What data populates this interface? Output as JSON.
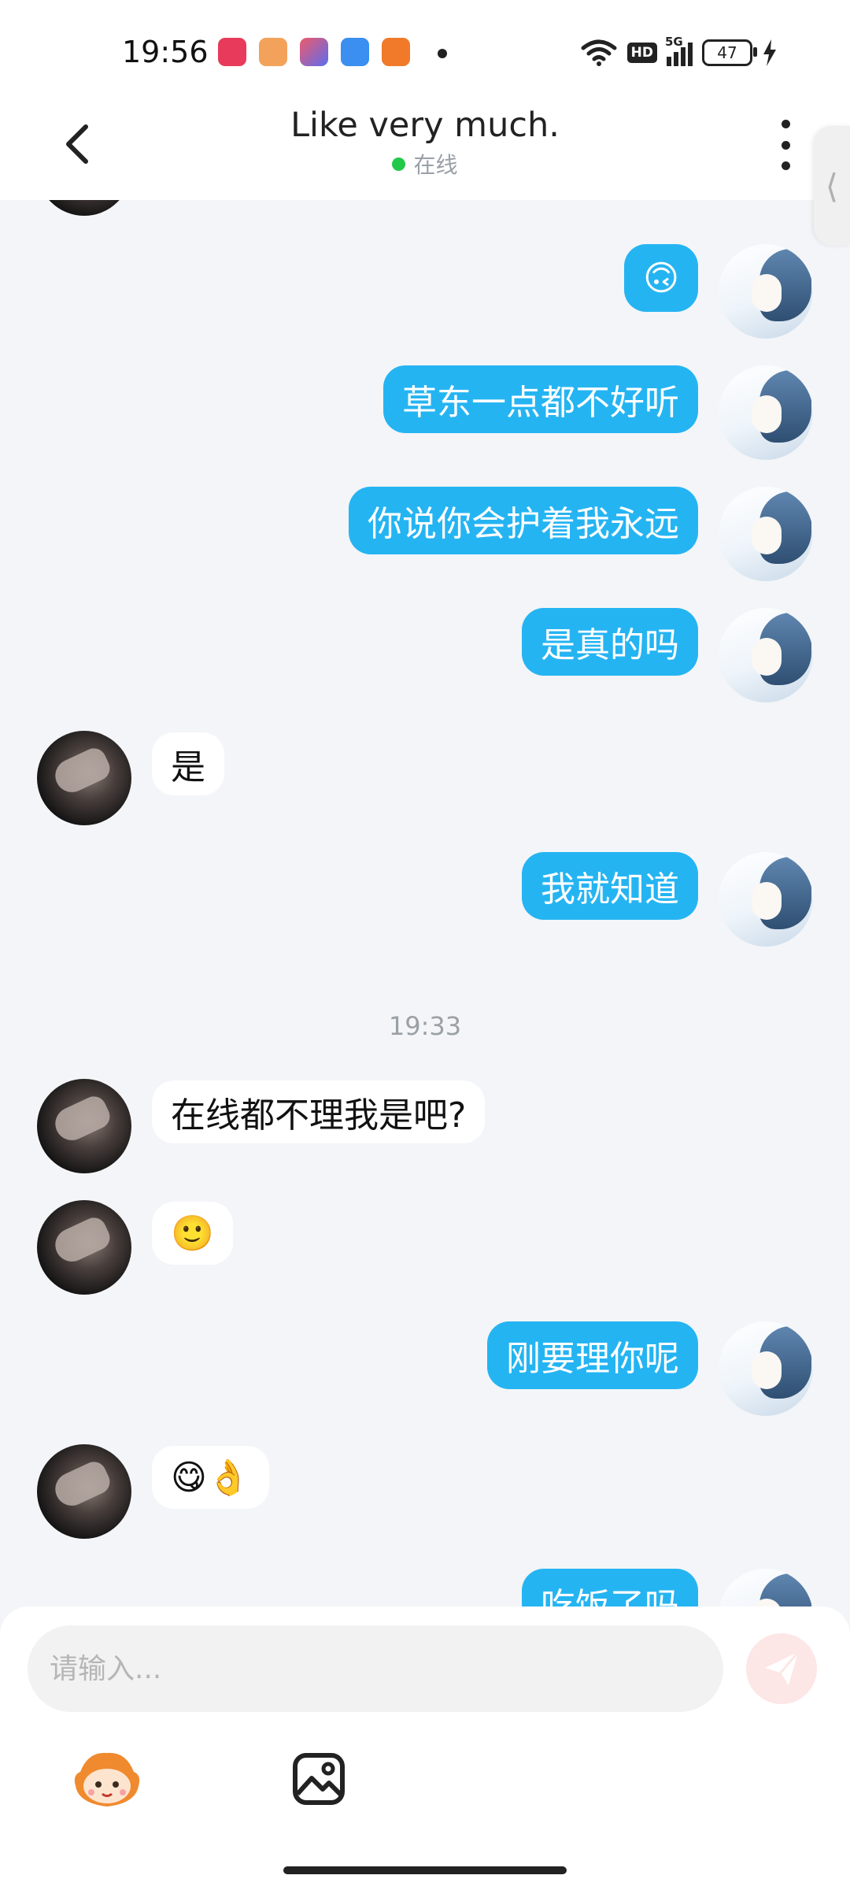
{
  "status_bar": {
    "time": "19:56",
    "battery": "47",
    "hd_label": "HD",
    "network": "5G",
    "app_icon_colors": [
      "#e83a5b",
      "#f06a2a",
      "#5a6cf0",
      "#3a8ff0",
      "#f07a2a"
    ]
  },
  "header": {
    "title": "Like very much.",
    "status": "在线",
    "status_color": "#22c84a"
  },
  "messages": [
    {
      "from": "self",
      "text": "🙃"
    },
    {
      "from": "self",
      "text": "草东一点都不好听"
    },
    {
      "from": "self",
      "text": "你说你会护着我永远"
    },
    {
      "from": "self",
      "text": "是真的吗"
    },
    {
      "from": "other",
      "text": "是"
    },
    {
      "from": "self",
      "text": "我就知道"
    },
    {
      "type": "time",
      "text": "19:33"
    },
    {
      "from": "other",
      "text": "在线都不理我是吧?"
    },
    {
      "from": "other",
      "text": "🙂"
    },
    {
      "from": "self",
      "text": "刚要理你呢"
    },
    {
      "from": "other",
      "text": "😋👌"
    },
    {
      "from": "self",
      "text": "吃饭了吗"
    }
  ],
  "input": {
    "placeholder": "请输入..."
  },
  "colors": {
    "self_bubble": "#25b4f2",
    "background": "#f3f5f8",
    "send_button": "#fde6e6"
  },
  "icons": [
    "back-arrow",
    "more-dots",
    "send-paper-plane",
    "mascot-sticker",
    "image-picture"
  ]
}
